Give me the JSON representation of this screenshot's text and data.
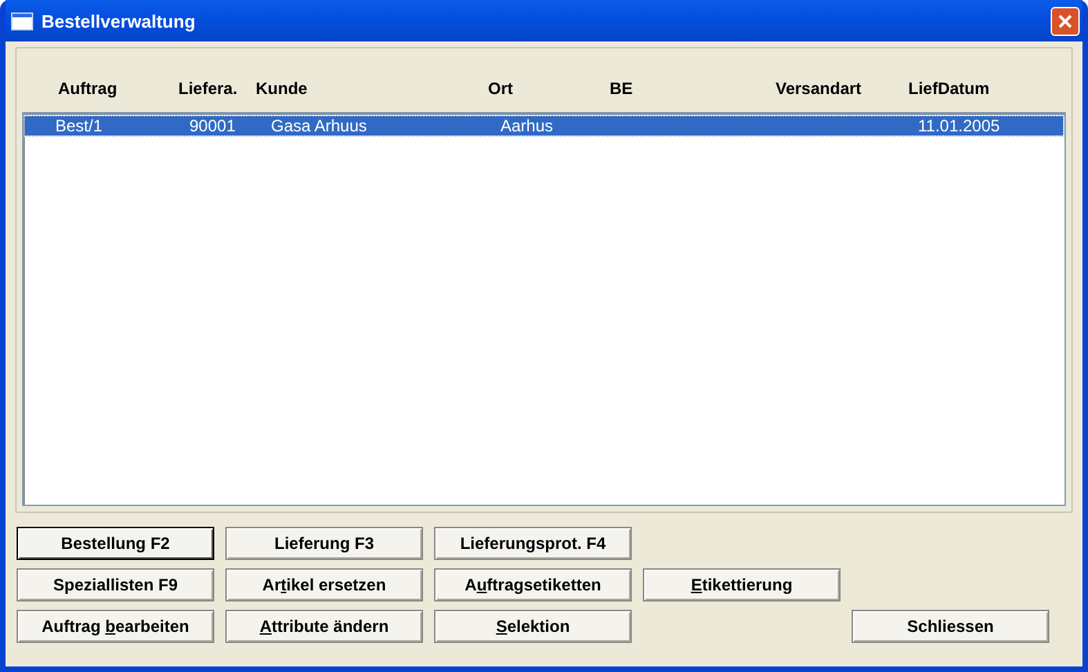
{
  "window": {
    "title": "Bestellverwaltung"
  },
  "table": {
    "columns": [
      "Auftrag",
      "Liefera.",
      "Kunde",
      "Ort",
      "BE",
      "Versandart",
      "LiefDatum"
    ],
    "rows": [
      {
        "selected": true,
        "cells": [
          "Best/1",
          "90001",
          "Gasa Arhuus",
          "Aarhus",
          "",
          "",
          "11.01.2005"
        ]
      }
    ]
  },
  "buttons": [
    {
      "kind": "default",
      "label": {
        "before": "Bestellung F2"
      }
    },
    {
      "kind": "normal",
      "label": {
        "before": "Lieferung F3"
      }
    },
    {
      "kind": "normal",
      "label": {
        "before": "Lieferungsprot. F4"
      }
    },
    {
      "kind": "break"
    },
    {
      "kind": "normal",
      "label": {
        "before": "Speziallisten F9"
      }
    },
    {
      "kind": "normal",
      "label": {
        "before": "Ar",
        "key": "t",
        "after": "ikel ersetzen"
      }
    },
    {
      "kind": "normal",
      "label": {
        "before": "A",
        "key": "u",
        "after": "ftragsetiketten"
      }
    },
    {
      "kind": "normal",
      "label": {
        "key": "E",
        "after": "tikettierung"
      }
    },
    {
      "kind": "break"
    },
    {
      "kind": "normal",
      "label": {
        "before": "Auftrag ",
        "key": "b",
        "after": "earbeiten"
      }
    },
    {
      "kind": "normal",
      "label": {
        "key": "A",
        "after": "ttribute ändern"
      }
    },
    {
      "kind": "normal",
      "label": {
        "key": "S",
        "after": "elektion"
      }
    },
    {
      "kind": "close",
      "label": {
        "before": "Schliessen"
      }
    }
  ]
}
